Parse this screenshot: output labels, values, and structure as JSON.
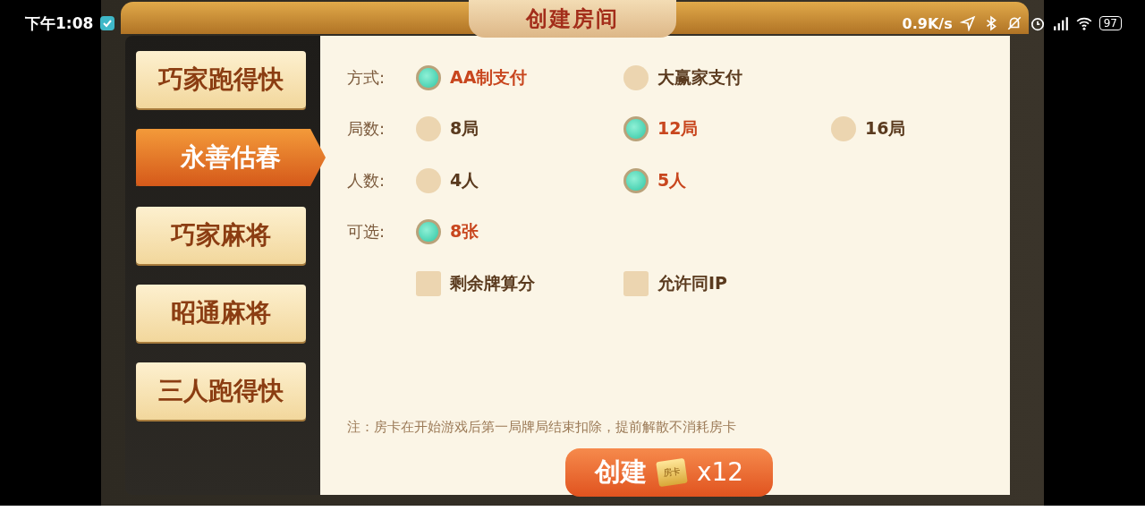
{
  "status_bar": {
    "time": "下午1:08",
    "net_speed": "0.9K/s",
    "battery": "97"
  },
  "title": "创建房间",
  "game_tabs": [
    {
      "label": "巧家跑得快",
      "selected": false
    },
    {
      "label": "永善估春",
      "selected": true
    },
    {
      "label": "巧家麻将",
      "selected": false
    },
    {
      "label": "昭通麻将",
      "selected": false
    },
    {
      "label": "三人跑得快",
      "selected": false
    }
  ],
  "options": [
    {
      "kind": "radio",
      "label": "方式:",
      "choices": [
        {
          "text": "AA制支付",
          "selected": true
        },
        {
          "text": "大赢家支付",
          "selected": false
        }
      ]
    },
    {
      "kind": "radio",
      "label": "局数:",
      "choices": [
        {
          "text": "8局",
          "selected": false
        },
        {
          "text": "12局",
          "selected": true
        },
        {
          "text": "16局",
          "selected": false
        }
      ]
    },
    {
      "kind": "radio",
      "label": "人数:",
      "choices": [
        {
          "text": "4人",
          "selected": false
        },
        {
          "text": "5人",
          "selected": true
        }
      ]
    },
    {
      "kind": "radio",
      "label": "可选:",
      "choices": [
        {
          "text": "8张",
          "selected": true
        }
      ]
    },
    {
      "kind": "checkbox",
      "choices": [
        {
          "text": "剩余牌算分",
          "checked": false
        },
        {
          "text": "允许同IP",
          "checked": false
        }
      ]
    }
  ],
  "note": "注：房卡在开始游戏后第一局牌局结束扣除，提前解散不消耗房卡",
  "create_button": {
    "label": "创建",
    "ticket": "房卡",
    "count": "x12"
  }
}
